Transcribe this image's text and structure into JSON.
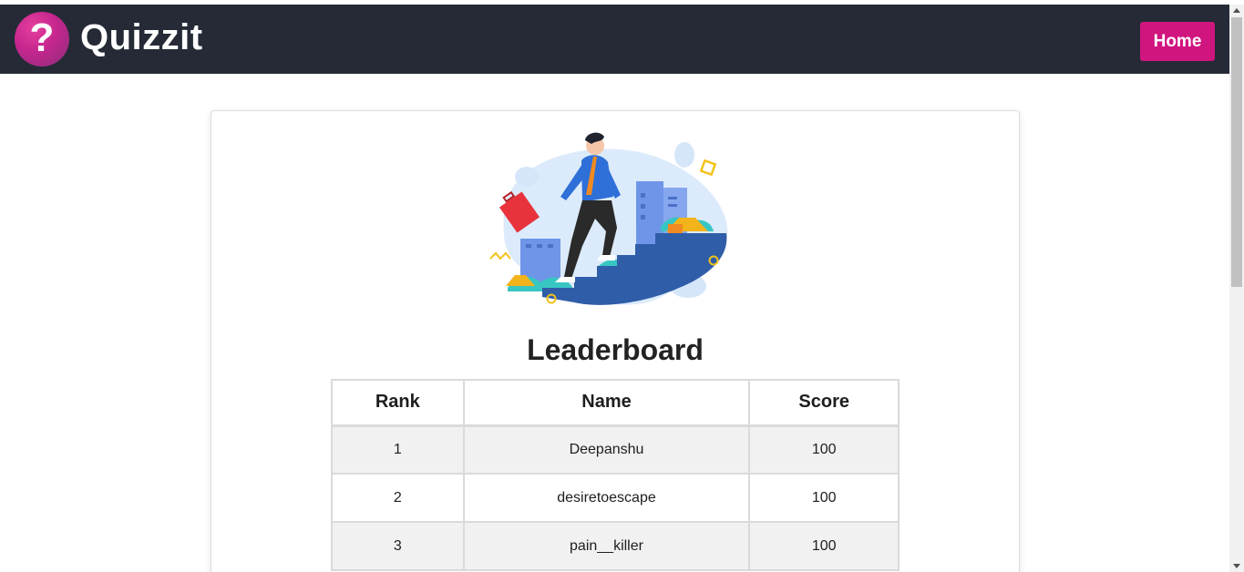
{
  "header": {
    "logo_glyph": "?",
    "brand": "Quizzit",
    "home_label": "Home"
  },
  "colors": {
    "navbar_bg": "#252a36",
    "accent": "#d0157f"
  },
  "leaderboard": {
    "title": "Leaderboard",
    "columns": [
      "Rank",
      "Name",
      "Score"
    ],
    "rows": [
      {
        "rank": "1",
        "name": "Deepanshu",
        "score": "100"
      },
      {
        "rank": "2",
        "name": "desiretoescape",
        "score": "100"
      },
      {
        "rank": "3",
        "name": "pain__killer",
        "score": "100"
      }
    ]
  }
}
